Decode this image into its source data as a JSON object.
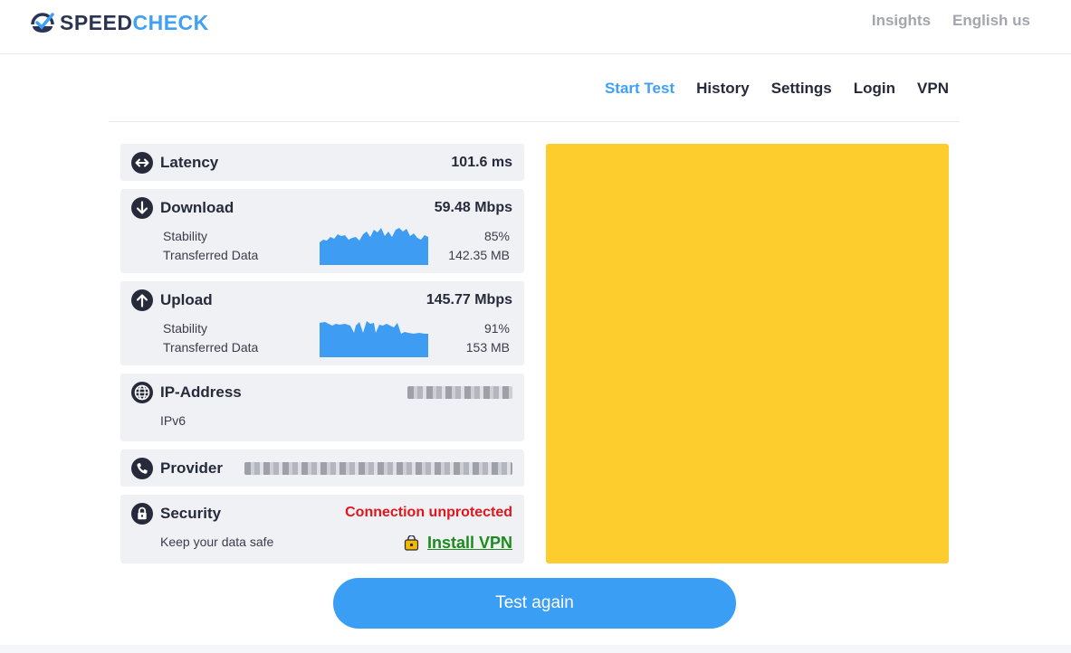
{
  "header": {
    "logo_part1": "SPEED",
    "logo_part2": "CHECK",
    "insights": "Insights",
    "language": "English us"
  },
  "nav": {
    "start_test": "Start Test",
    "history": "History",
    "settings": "Settings",
    "login": "Login",
    "vpn": "VPN"
  },
  "latency": {
    "label": "Latency",
    "value": "101.6 ms"
  },
  "download": {
    "label": "Download",
    "value": "59.48 Mbps",
    "stability_label": "Stability",
    "stability_value": "85%",
    "transferred_label": "Transferred Data",
    "transferred_value": "142.35 MB"
  },
  "upload": {
    "label": "Upload",
    "value": "145.77 Mbps",
    "stability_label": "Stability",
    "stability_value": "91%",
    "transferred_label": "Transferred Data",
    "transferred_value": "153 MB"
  },
  "ip": {
    "label": "IP-Address",
    "version": "IPv6"
  },
  "provider": {
    "label": "Provider"
  },
  "security": {
    "label": "Security",
    "status": "Connection unprotected",
    "subtitle": "Keep your data safe",
    "install_vpn": "Install VPN"
  },
  "test_again": "Test again",
  "colors": {
    "accent": "#3fa0f5",
    "button": "#3a9ef4",
    "warning": "#e0161c",
    "vpn_link": "#1c8a1c",
    "ad_placeholder": "#fdcd2e",
    "card_bg": "#f0f1f5"
  },
  "icons": {
    "latency": "arrows-horizontal-icon",
    "download": "arrow-down-circle-icon",
    "upload": "arrow-up-circle-icon",
    "ip": "globe-icon",
    "provider": "phone-icon",
    "security": "lock-icon",
    "vpn": "vpn-key-icon"
  }
}
